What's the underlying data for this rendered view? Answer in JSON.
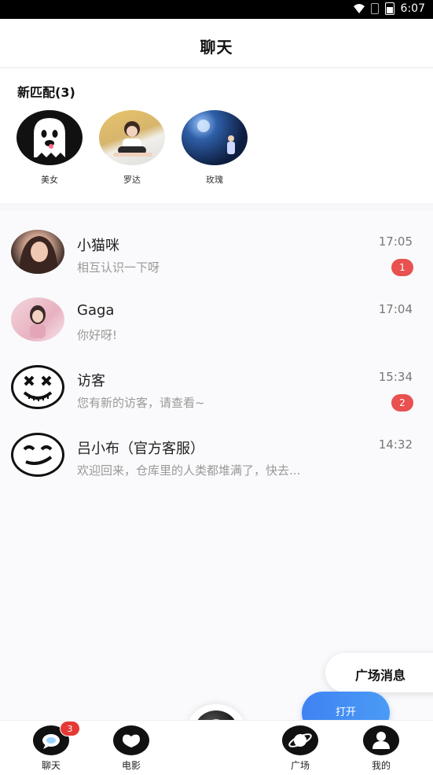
{
  "status_bar": {
    "time": "6:07"
  },
  "header": {
    "title": "聊天"
  },
  "new_matches": {
    "title": "新匹配(3)",
    "items": [
      {
        "name": "美女"
      },
      {
        "name": "罗达"
      },
      {
        "name": "玫瑰"
      }
    ]
  },
  "chats": [
    {
      "name": "小猫咪",
      "message": "相互认识一下呀",
      "time": "17:05",
      "unread": "1"
    },
    {
      "name": "Gaga",
      "message": "你好呀!",
      "time": "17:04",
      "unread": ""
    },
    {
      "name": "访客",
      "message": "您有新的访客，请查看~",
      "time": "15:34",
      "unread": "2"
    },
    {
      "name": "吕小布（官方客服）",
      "message": "欢迎回来，仓库里的人类都堆满了，快去...",
      "time": "14:32",
      "unread": ""
    }
  ],
  "floating": {
    "plaza_message": "广场消息",
    "open_button": "打开"
  },
  "tabbar": {
    "items": [
      {
        "label": "聊天",
        "badge": "3"
      },
      {
        "label": "电影"
      },
      {
        "label": "广场"
      },
      {
        "label": "我的"
      }
    ]
  },
  "colors": {
    "accent_blue": "#3f82f2",
    "badge_red": "#e8514f"
  }
}
